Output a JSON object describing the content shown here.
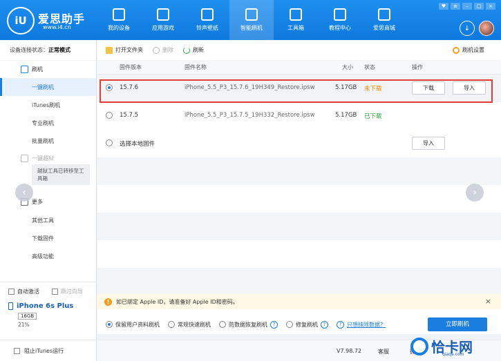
{
  "app": {
    "brand": "爱思助手",
    "url": "www.i4.cn"
  },
  "nav": [
    {
      "label": "我的设备",
      "icon": "device-icon"
    },
    {
      "label": "应用游戏",
      "icon": "app-store-icon"
    },
    {
      "label": "铃声壁纸",
      "icon": "ringtone-icon"
    },
    {
      "label": "智能刷机",
      "icon": "refresh-icon",
      "active": true
    },
    {
      "label": "工具箱",
      "icon": "toolbox-icon"
    },
    {
      "label": "教程中心",
      "icon": "graduation-cap-icon"
    },
    {
      "label": "爱思商城",
      "icon": "store-icon"
    }
  ],
  "sidebar": {
    "status_label": "设备连接状态：",
    "status_value": "正常模式",
    "flash_group": "刷机",
    "items": [
      "一键刷机",
      "iTunes刷机",
      "专业刷机",
      "批量刷机"
    ],
    "jailbreak_group": "一键越狱",
    "jailbreak_note": "越狱工具已转移至工具箱",
    "more_group": "更多",
    "more_items": [
      "其他工具",
      "下载固件",
      "高级功能"
    ],
    "auto_activate": "自动激活",
    "skip_guide": "跳过向导",
    "device_name": "iPhone 6s Plus",
    "device_storage": "16GB",
    "device_battery": "21%",
    "block_itunes": "阻止iTunes运行"
  },
  "toolbar": {
    "open_folder": "打开文件夹",
    "delete": "删除",
    "refresh": "刷新",
    "settings": "刷机设置"
  },
  "table": {
    "headers": {
      "version": "固件版本",
      "name": "固件名称",
      "size": "大小",
      "status": "状态",
      "action": "操作"
    },
    "rows": [
      {
        "version": "15.7.6",
        "name": "iPhone_5.5_P3_15.7.6_19H349_Restore.ipsw",
        "size": "5.17GB",
        "status": "未下载",
        "status_color": "#f08a00",
        "download": "下载",
        "import": "导入"
      },
      {
        "version": "15.7.5",
        "name": "iPhone_5.5_P3_15.7.5_19H332_Restore.ipsw",
        "size": "5.17GB",
        "status": "已下载",
        "status_color": "#23a33b"
      }
    ],
    "local_option": "选择本地固件",
    "local_import": "导入"
  },
  "notice": {
    "text": "如已绑定 Apple ID，请准备好 Apple ID和密码。"
  },
  "options": {
    "keep_data": "保留用户资料刷机",
    "quick": "常规快速刷机",
    "anti_recovery": "防数据恢复刷机",
    "repair": "修复刷机",
    "erase_link": "只想抹除数据？",
    "flash_now": "立即刷机"
  },
  "footer": {
    "version": "V7.98.72",
    "service": "客服",
    "wechat": "微"
  },
  "watermark": {
    "text": "恰卡网",
    "sub": "qiaqa.com"
  },
  "colors": {
    "primary": "#1a7de0",
    "highlight": "#e33b36"
  }
}
